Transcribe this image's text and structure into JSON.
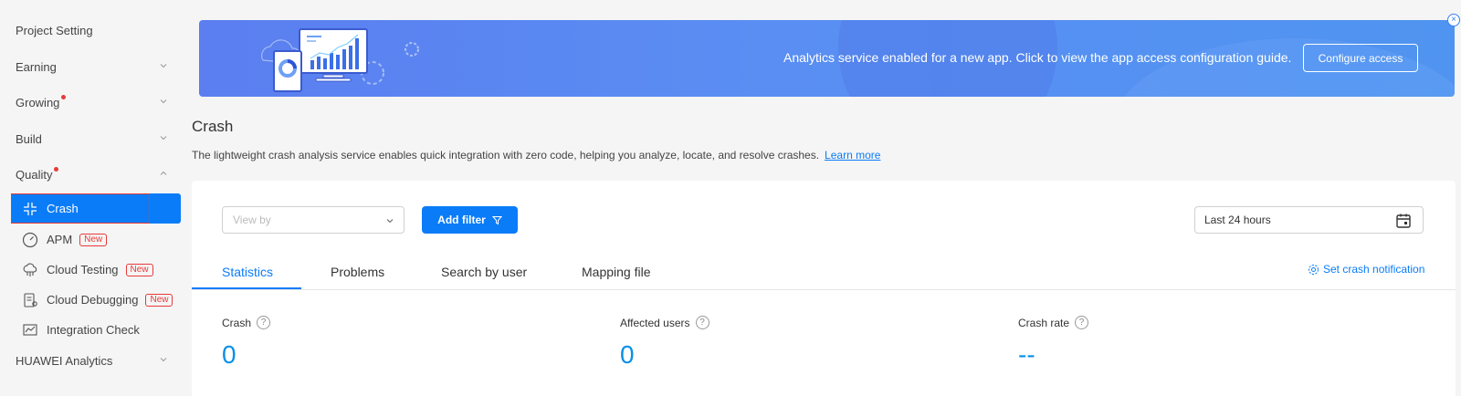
{
  "sidebar": {
    "items": [
      {
        "label": "Project Setting"
      },
      {
        "label": "Earning"
      },
      {
        "label": "Growing"
      },
      {
        "label": "Build"
      },
      {
        "label": "Quality"
      },
      {
        "label": "HUAWEI Analytics"
      }
    ],
    "quality_sub": [
      {
        "label": "Crash",
        "icon": "crash-icon"
      },
      {
        "label": "APM",
        "badge": "New",
        "icon": "gauge-icon"
      },
      {
        "label": "Cloud Testing",
        "badge": "New",
        "icon": "cloud-test-icon"
      },
      {
        "label": "Cloud Debugging",
        "badge": "New",
        "icon": "cloud-debug-icon"
      },
      {
        "label": "Integration Check",
        "icon": "chart-check-icon"
      }
    ]
  },
  "banner": {
    "message": "Analytics service enabled for a new app. Click to view the app access configuration guide.",
    "button": "Configure access",
    "close": "×"
  },
  "page": {
    "title": "Crash",
    "description": "The lightweight crash analysis service enables quick integration with zero code, helping you analyze, locate, and resolve crashes.",
    "learn_more": "Learn more"
  },
  "toolbar": {
    "viewby_placeholder": "View by",
    "add_filter": "Add filter",
    "date_range": "Last 24 hours"
  },
  "tabs": [
    {
      "label": "Statistics"
    },
    {
      "label": "Problems"
    },
    {
      "label": "Search by user"
    },
    {
      "label": "Mapping file"
    }
  ],
  "set_notification": "Set crash notification",
  "metrics": [
    {
      "label": "Crash",
      "value": "0"
    },
    {
      "label": "Affected users",
      "value": "0"
    },
    {
      "label": "Crash rate",
      "value": "--"
    }
  ],
  "colors": {
    "accent": "#0a7cf8",
    "value": "#0a90e6",
    "badge": "#e83a3a"
  }
}
